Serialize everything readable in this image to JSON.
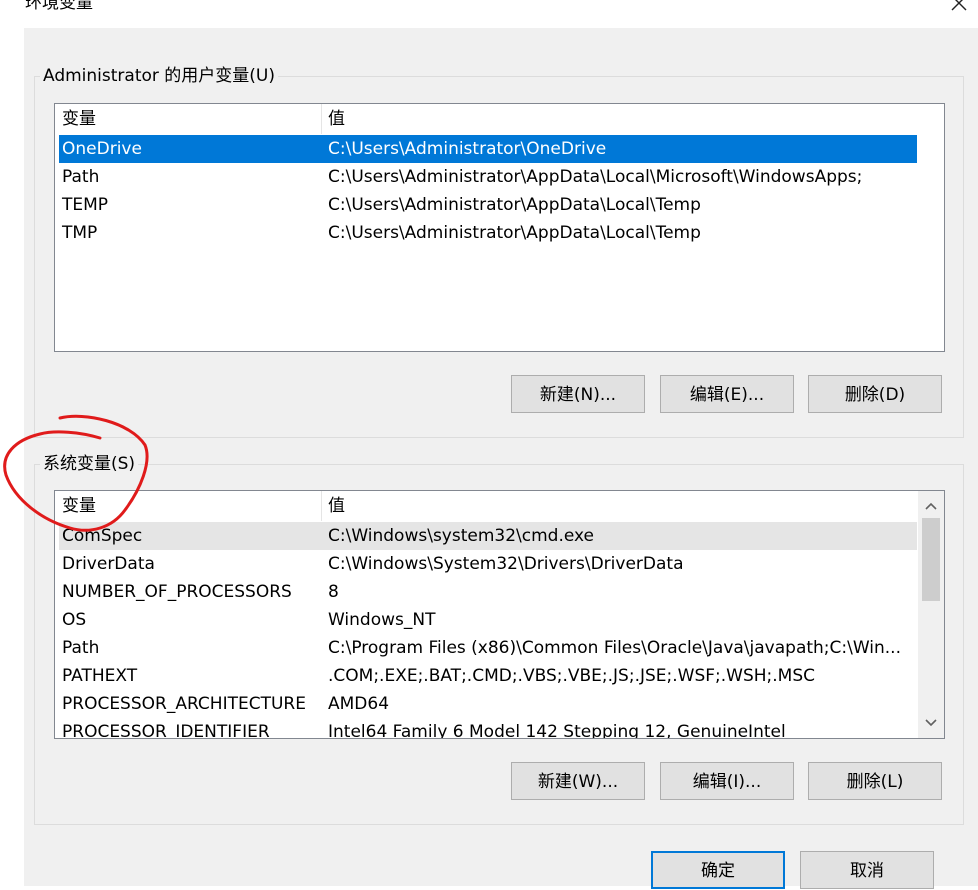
{
  "window": {
    "title": "环境变量"
  },
  "user_vars": {
    "group_label": "Administrator 的用户变量(U)",
    "columns": [
      "变量",
      "值"
    ],
    "rows": [
      {
        "name": "OneDrive",
        "value": "C:\\Users\\Administrator\\OneDrive"
      },
      {
        "name": "Path",
        "value": "C:\\Users\\Administrator\\AppData\\Local\\Microsoft\\WindowsApps;"
      },
      {
        "name": "TEMP",
        "value": "C:\\Users\\Administrator\\AppData\\Local\\Temp"
      },
      {
        "name": "TMP",
        "value": "C:\\Users\\Administrator\\AppData\\Local\\Temp"
      }
    ],
    "selected_index": 0,
    "buttons": {
      "new": "新建(N)...",
      "edit": "编辑(E)...",
      "delete": "删除(D)"
    }
  },
  "system_vars": {
    "group_label": "系统变量(S)",
    "columns": [
      "变量",
      "值"
    ],
    "rows": [
      {
        "name": "ComSpec",
        "value": "C:\\Windows\\system32\\cmd.exe"
      },
      {
        "name": "DriverData",
        "value": "C:\\Windows\\System32\\Drivers\\DriverData"
      },
      {
        "name": "NUMBER_OF_PROCESSORS",
        "value": "8"
      },
      {
        "name": "OS",
        "value": "Windows_NT"
      },
      {
        "name": "Path",
        "value": "C:\\Program Files (x86)\\Common Files\\Oracle\\Java\\javapath;C:\\Win..."
      },
      {
        "name": "PATHEXT",
        "value": ".COM;.EXE;.BAT;.CMD;.VBS;.VBE;.JS;.JSE;.WSF;.WSH;.MSC"
      },
      {
        "name": "PROCESSOR_ARCHITECTURE",
        "value": "AMD64"
      },
      {
        "name": "PROCESSOR_IDENTIFIER",
        "value": "Intel64 Family 6 Model 142 Stepping 12, GenuineIntel"
      }
    ],
    "hover_index": 0,
    "buttons": {
      "new": "新建(W)...",
      "edit": "编辑(I)...",
      "delete": "删除(L)"
    }
  },
  "dialog_buttons": {
    "ok": "确定",
    "cancel": "取消"
  },
  "colors": {
    "selection": "#0078d7",
    "hover": "#e5e5e5",
    "annotation": "#e01b1b"
  }
}
